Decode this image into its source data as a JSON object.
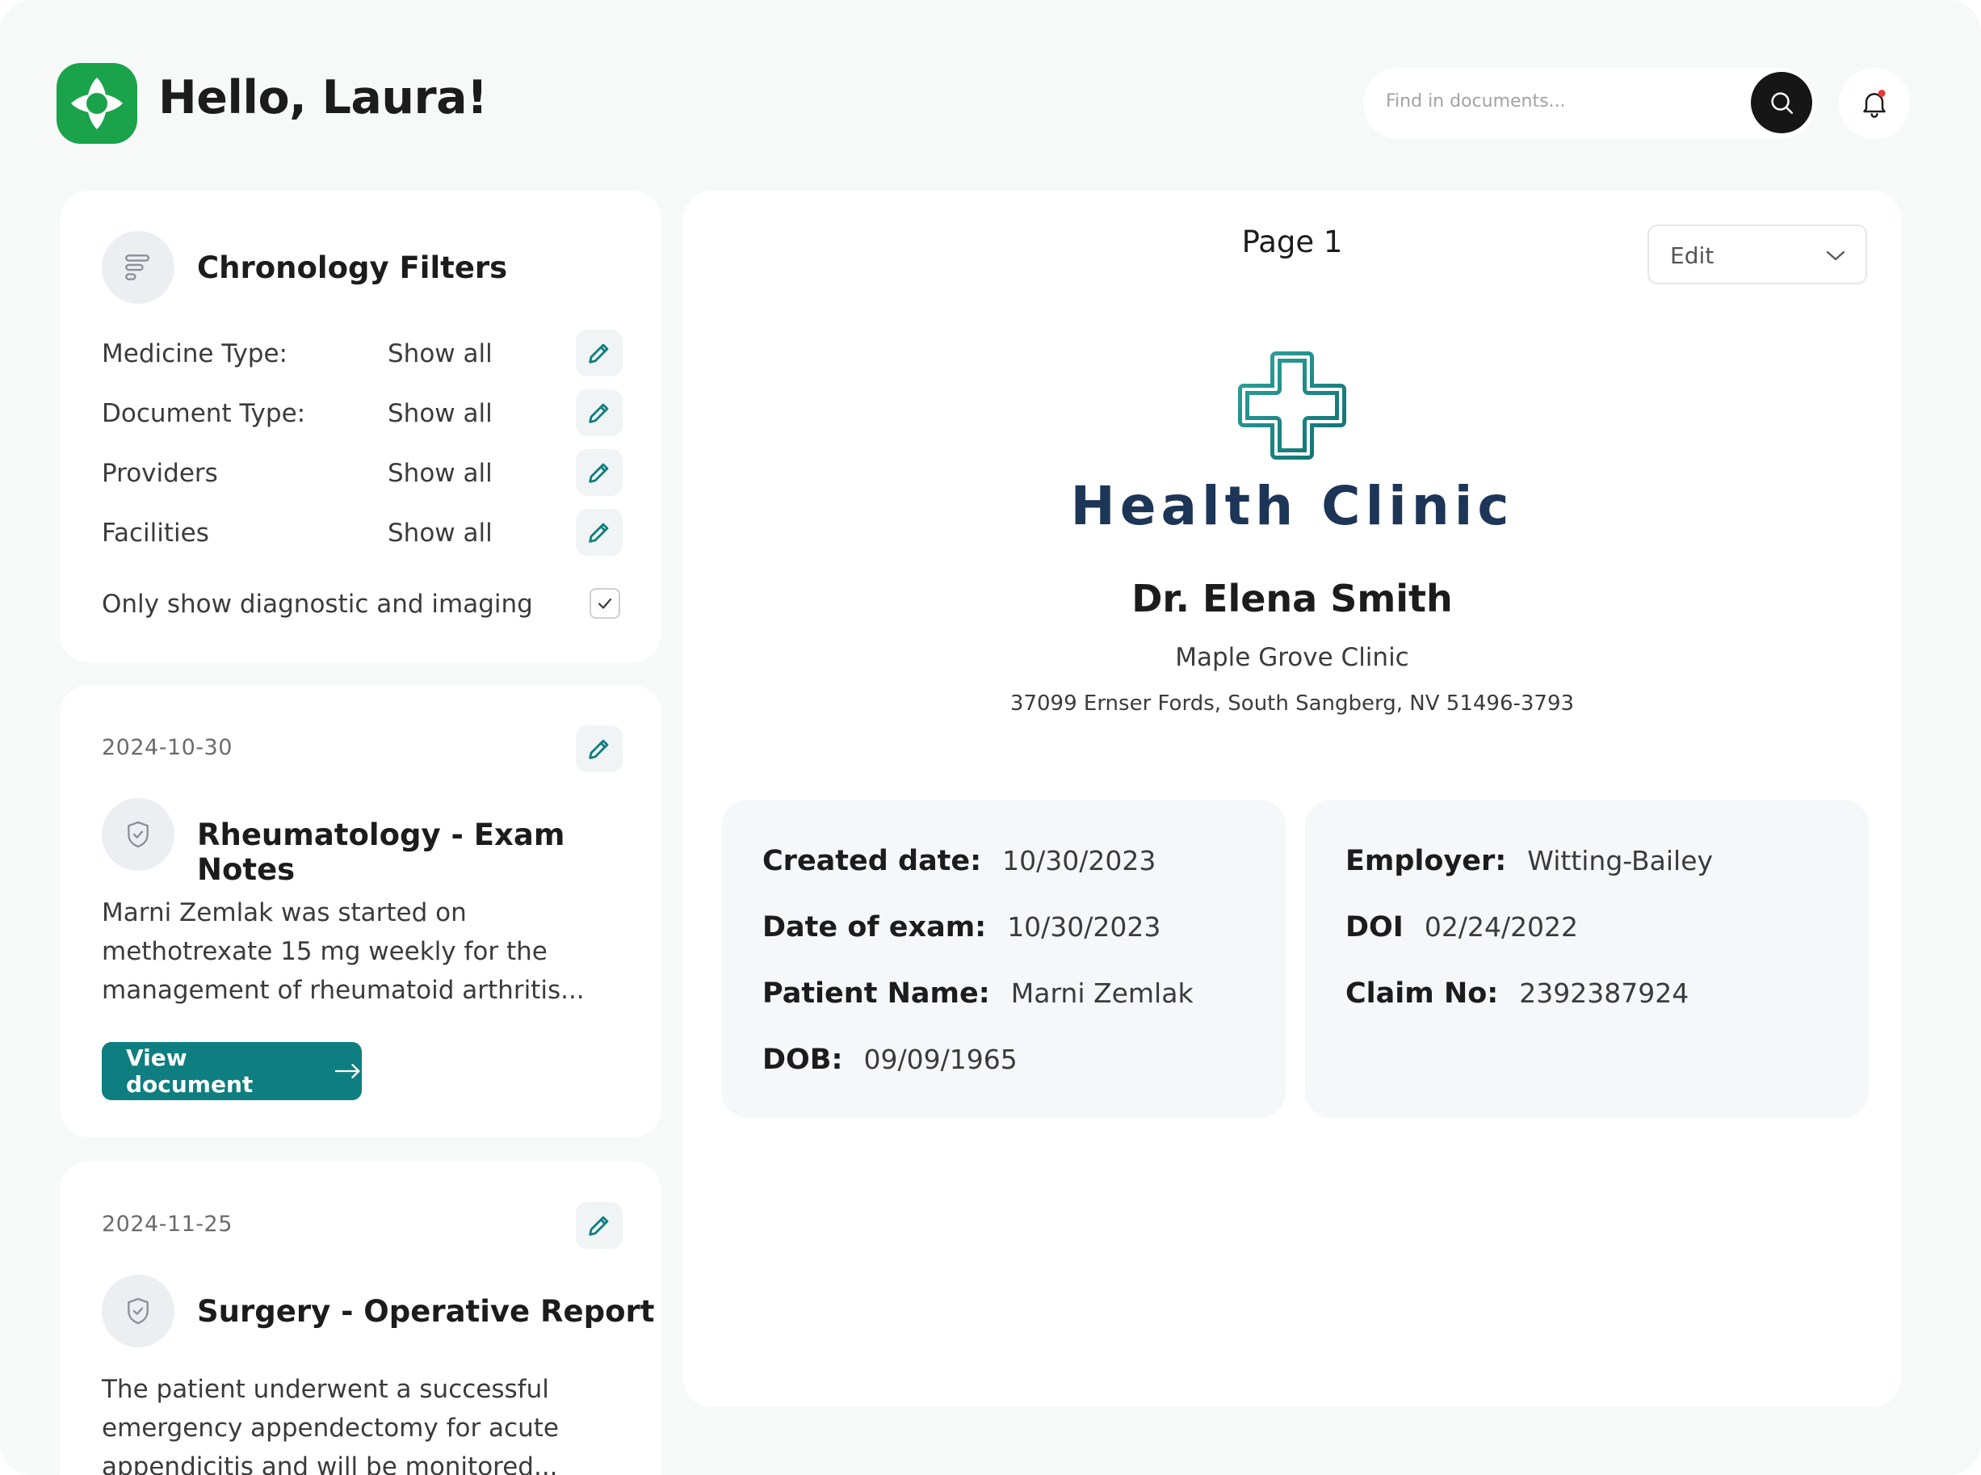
{
  "header": {
    "greeting": "Hello, Laura!",
    "search": {
      "placeholder": "Find in documents..."
    },
    "icons": {
      "logo": "brand-logo",
      "search": "search-icon",
      "notifications": "bell-icon"
    },
    "accent_color": "#0e7e80",
    "notification_dot_color": "#e53935"
  },
  "filters": {
    "title": "Chronology Filters",
    "items": [
      {
        "label": "Medicine Type:",
        "value": "Show all"
      },
      {
        "label": "Document Type:",
        "value": "Show all"
      },
      {
        "label": "Providers",
        "value": "Show all"
      },
      {
        "label": "Facilities",
        "value": "Show all"
      }
    ],
    "checkbox": {
      "label": "Only show diagnostic and imaging",
      "checked": true
    }
  },
  "documents": [
    {
      "date": "2024-10-30",
      "title": "Rheumatology - Exam Notes",
      "description": "Marni Zemlak was started on methotrexate 15 mg weekly for the management of rheumatoid arthritis...",
      "button_label": "View document"
    },
    {
      "date": "2024-11-25",
      "title": "Surgery - Operative Report",
      "description": "The patient underwent a successful emergency appendectomy for acute appendicitis and will be monitored..."
    }
  ],
  "viewer": {
    "page_label": "Page 1",
    "edit_select": {
      "value": "Edit"
    },
    "clinic_name": "Health Clinic",
    "doctor": "Dr. Elena Smith",
    "clinic": "Maple Grove Clinic",
    "address": "37099 Ernser Fords, South Sangberg, NV 51496-3793",
    "left_info": [
      {
        "key": "Created date:",
        "value": "10/30/2023"
      },
      {
        "key": "Date of exam:",
        "value": "10/30/2023"
      },
      {
        "key": "Patient Name:",
        "value": "Marni Zemlak"
      },
      {
        "key": "DOB:",
        "value": "09/09/1965"
      }
    ],
    "right_info": [
      {
        "key": "Employer:",
        "value": "Witting-Bailey"
      },
      {
        "key": "DOI",
        "value": "02/24/2022"
      },
      {
        "key": "Claim No:",
        "value": "2392387924"
      }
    ]
  }
}
